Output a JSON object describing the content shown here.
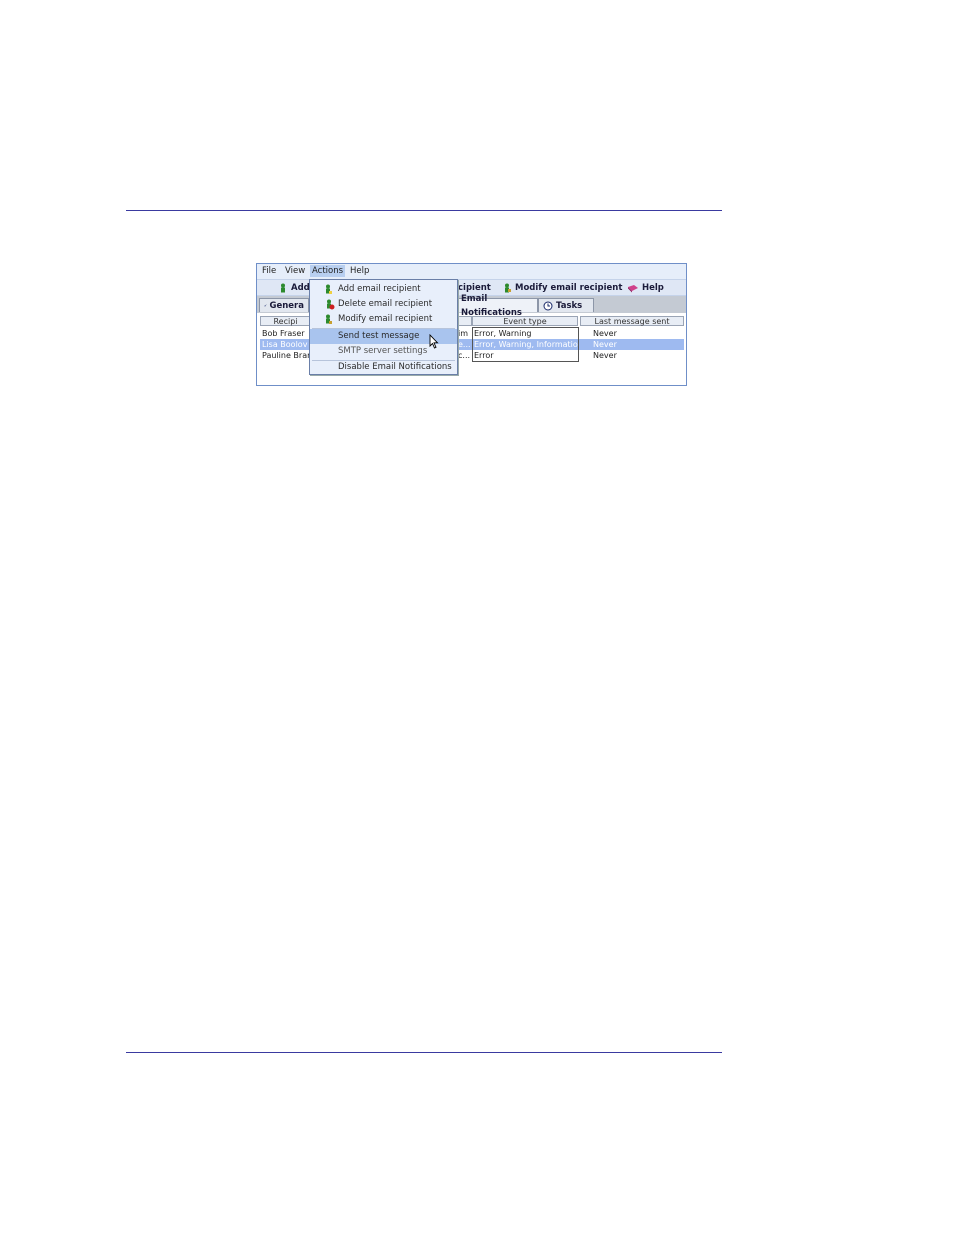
{
  "menubar": {
    "file": "File",
    "view": "View",
    "actions": "Actions",
    "help": "Help"
  },
  "toolbar": {
    "add_partial": "Add",
    "delete_partial": "cipient",
    "modify": "Modify email recipient",
    "help": "Help"
  },
  "tabs": {
    "general_partial": "Genera",
    "email_partial": "Email Notifications",
    "tasks": "Tasks"
  },
  "table": {
    "headers": {
      "recipient_partial": "Recipi",
      "event_type": "Event type",
      "last_sent": "Last message sent"
    },
    "rows": [
      {
        "recipient": "Bob Fraser",
        "mid": "im",
        "event": "Error, Warning",
        "last": "Never"
      },
      {
        "recipient": "Lisa Boolov",
        "mid": "e...",
        "event": "Error, Warning, Informatio...",
        "last": "Never"
      },
      {
        "recipient": "Pauline Brar",
        "mid": "c...",
        "event": "Error",
        "last": "Never"
      }
    ]
  },
  "actions_menu": {
    "items": [
      {
        "label": "Add email recipient",
        "icon": "add-person-icon"
      },
      {
        "label": "Delete email recipient",
        "icon": "delete-person-icon"
      },
      {
        "label": "Modify email recipient",
        "icon": "modify-person-icon"
      },
      {
        "label": "Send test message",
        "icon": ""
      },
      {
        "label": "SMTP server settings",
        "icon": ""
      },
      {
        "label": "Disable Email Notifications",
        "icon": ""
      }
    ],
    "highlighted": "Send test message"
  },
  "colors": {
    "rule": "#3a3aa0",
    "highlight": "#a9c4ee",
    "selected_row": "#9ebaf0"
  }
}
